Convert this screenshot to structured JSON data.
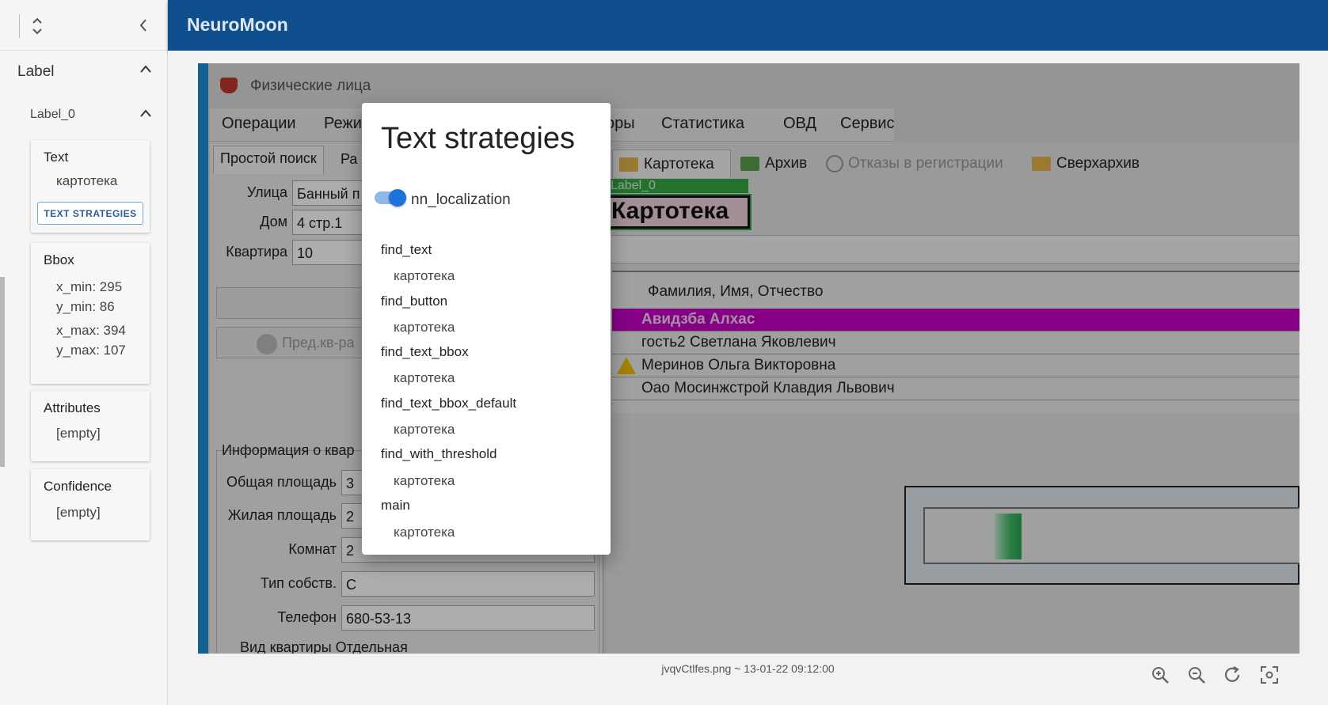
{
  "app": {
    "title": "NeuroMoon"
  },
  "sidebar": {
    "section_label": "Label",
    "subsection_label": "Label_0",
    "text_card": {
      "title": "Text",
      "value": "картотека",
      "button_label": "TEXT STRATEGIES"
    },
    "bbox_card": {
      "title": "Bbox",
      "x_min": "x_min: 295",
      "y_min": "y_min: 86",
      "x_max": "x_max: 394",
      "y_max": "y_max: 107"
    },
    "attributes_card": {
      "title": "Attributes",
      "value": "[empty]"
    },
    "confidence_card": {
      "title": "Confidence",
      "value": "[empty]"
    }
  },
  "screenshot": {
    "window_title": "Физические лица",
    "menu": [
      "Операции",
      "Режи",
      "оры",
      "Статистика",
      "ОВД",
      "Сервис"
    ],
    "left_tabs": {
      "simple_search": "Простой поиск",
      "ra": "Ра"
    },
    "fields": {
      "street_label": "Улица",
      "street_value": "Банный п",
      "house_label": "Дом",
      "house_value": "4 стр.1",
      "apt_label": "Квартира",
      "apt_value": "10"
    },
    "prev_button": "Пред.кв-ра",
    "group_title": "Информация о квар",
    "info_labels": {
      "total_area": "Общая площадь",
      "living_area": "Жилая площадь",
      "rooms": "Комнат",
      "ownership": "Тип собств.",
      "phone": "Телефон",
      "apt_type": "Вид квартиры Отдельная"
    },
    "phone_value": "680-53-13",
    "total_area_value": "3",
    "living_area_value": "2",
    "rooms_value": "2",
    "ownership_value": "С",
    "right_tabs": [
      "Картотека",
      "Архив",
      "Отказы в регистрации",
      "Сверхархив"
    ],
    "label_tag": "Label_0",
    "label_big": "Картотека",
    "table_header": "Фамилия, Имя, Отчество",
    "rows": [
      "Авидзба Алхас",
      "гость2 Светлана Яковлевич",
      "Меринов Ольга Викторовна",
      "Оао Мосинжстрой Клавдия Львович"
    ]
  },
  "caption": "jvqvCtlfes.png ~ 13-01-22 09:12:00",
  "modal": {
    "title": "Text strategies",
    "toggle_label": "nn_localization",
    "toggle_on": true,
    "strategies": [
      {
        "name": "find_text",
        "value": "картотека"
      },
      {
        "name": "find_button",
        "value": "картотека"
      },
      {
        "name": "find_text_bbox",
        "value": "картотека"
      },
      {
        "name": "find_text_bbox_default",
        "value": "картотека"
      },
      {
        "name": "find_with_threshold",
        "value": "картотека"
      },
      {
        "name": "main",
        "value": "картотека"
      }
    ]
  },
  "icons": {
    "expand": "unfold-icon",
    "collapse_sidebar": "chevron-left-icon",
    "zoom_in": "zoom-in-icon",
    "zoom_out": "zoom-out-icon",
    "rotate": "rotate-icon",
    "fit": "fit-screen-icon"
  },
  "colors": {
    "topbar": "#0f4f8e",
    "accent": "#1e73d8",
    "selected_row": "#c400c4",
    "label_box": "#37a846"
  }
}
